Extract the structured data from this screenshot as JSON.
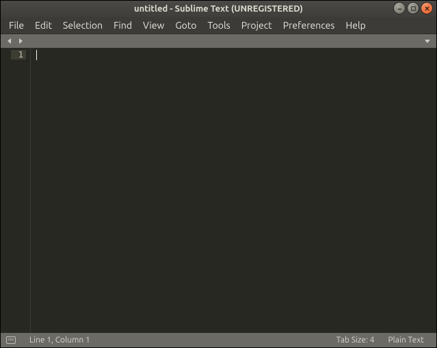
{
  "window": {
    "title": "untitled - Sublime Text (UNREGISTERED)"
  },
  "menu": {
    "items": [
      "File",
      "Edit",
      "Selection",
      "Find",
      "View",
      "Goto",
      "Tools",
      "Project",
      "Preferences",
      "Help"
    ]
  },
  "editor": {
    "line_numbers": [
      "1"
    ],
    "content": ""
  },
  "statusbar": {
    "position": "Line 1, Column 1",
    "tab_size": "Tab Size: 4",
    "syntax": "Plain Text"
  }
}
